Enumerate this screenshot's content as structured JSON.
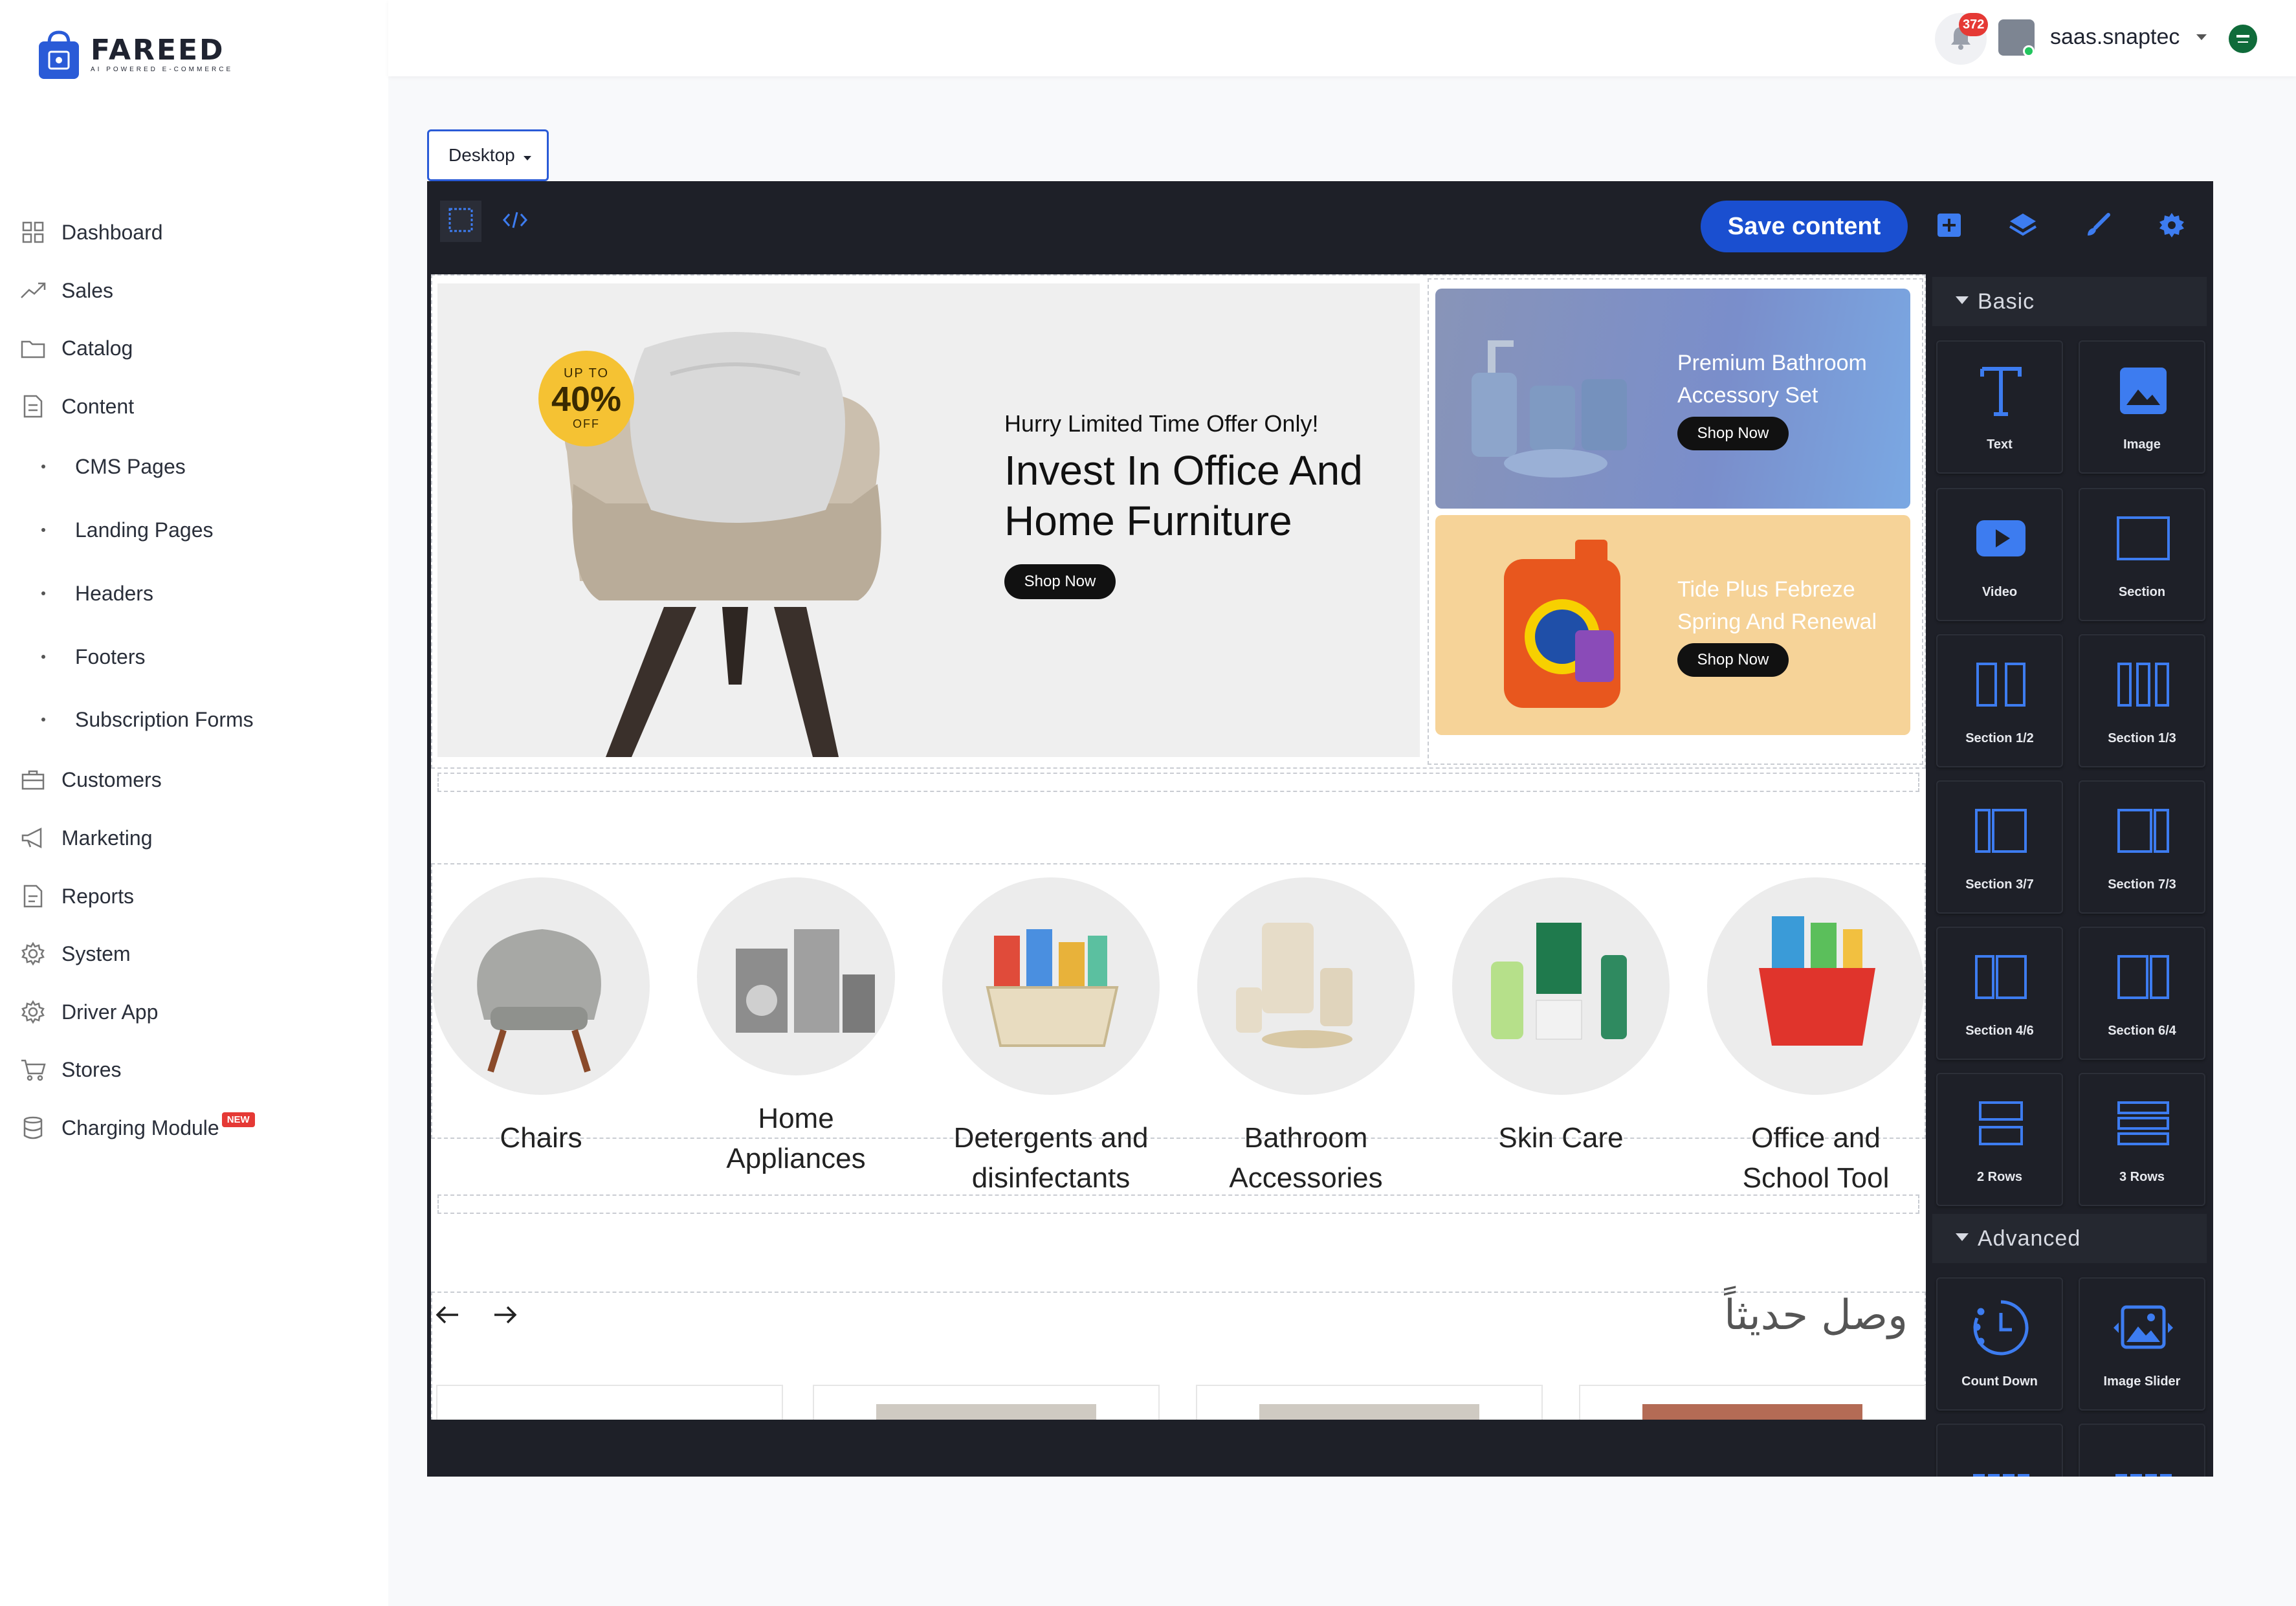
{
  "brand": {
    "name": "FAREED",
    "tagline": "AI POWERED E-COMMERCE"
  },
  "sidebar": {
    "items": [
      {
        "label": "Dashboard",
        "icon": "grid-icon"
      },
      {
        "label": "Sales",
        "icon": "trending-up-icon"
      },
      {
        "label": "Catalog",
        "icon": "folder-icon"
      },
      {
        "label": "Content",
        "icon": "document-icon"
      },
      {
        "label": "CMS Pages",
        "sub": true
      },
      {
        "label": "Landing Pages",
        "sub": true
      },
      {
        "label": "Headers",
        "sub": true
      },
      {
        "label": "Footers",
        "sub": true
      },
      {
        "label": "Subscription Forms",
        "sub": true
      },
      {
        "label": "Customers",
        "icon": "briefcase-icon"
      },
      {
        "label": "Marketing",
        "icon": "megaphone-icon"
      },
      {
        "label": "Reports",
        "icon": "report-icon"
      },
      {
        "label": "System",
        "icon": "gear-icon"
      },
      {
        "label": "Driver App",
        "icon": "gear-icon"
      },
      {
        "label": "Stores",
        "icon": "cart-icon"
      },
      {
        "label": "Charging Module",
        "icon": "database-icon",
        "badge": "NEW"
      }
    ]
  },
  "topbar": {
    "notification_count": "372",
    "username": "saas.snaptec"
  },
  "device_select": {
    "value": "Desktop"
  },
  "editor": {
    "save_label": "Save content"
  },
  "hero": {
    "badge_top": "UP TO",
    "badge_percent": "40%",
    "badge_bottom": "OFF",
    "eyebrow": "Hurry Limited Time Offer Only!",
    "title": "Invest In Office And Home Furniture",
    "button": "Shop Now"
  },
  "promos": [
    {
      "title": "Premium Bathroom Accessory Set",
      "button": "Shop Now"
    },
    {
      "title": "Tide Plus Febreze Spring And Renewal",
      "button": "Shop Now"
    }
  ],
  "categories": [
    {
      "name": "Chairs"
    },
    {
      "name": "Home Appliances"
    },
    {
      "name": "Detergents and disinfectants"
    },
    {
      "name": "Bathroom Accessories"
    },
    {
      "name": "Skin Care"
    },
    {
      "name": "Office and School Tool"
    }
  ],
  "new_arrivals": {
    "title": "وصل حديثاً"
  },
  "panel": {
    "basic_label": "Basic",
    "advanced_label": "Advanced",
    "basic_blocks": [
      {
        "label": "Text",
        "icon": "text-icon"
      },
      {
        "label": "Image",
        "icon": "image-icon"
      },
      {
        "label": "Video",
        "icon": "video-icon"
      },
      {
        "label": "Section",
        "icon": "section-icon"
      },
      {
        "label": "Section 1/2",
        "icon": "columns-2-icon"
      },
      {
        "label": "Section 1/3",
        "icon": "columns-3-icon"
      },
      {
        "label": "Section 3/7",
        "icon": "section-3-7-icon"
      },
      {
        "label": "Section 7/3",
        "icon": "section-7-3-icon"
      },
      {
        "label": "Section 4/6",
        "icon": "section-4-6-icon"
      },
      {
        "label": "Section 6/4",
        "icon": "section-6-4-icon"
      },
      {
        "label": "2 Rows",
        "icon": "rows-2-icon"
      },
      {
        "label": "3 Rows",
        "icon": "rows-3-icon"
      }
    ],
    "advanced_blocks": [
      {
        "label": "Count Down",
        "icon": "countdown-icon"
      },
      {
        "label": "Image Slider",
        "icon": "image-slider-icon"
      }
    ]
  },
  "colors": {
    "accent": "#1a4fd0",
    "panel_bg": "#1e2028",
    "block_icon": "#3d7cf0",
    "badge": "#e53935"
  }
}
